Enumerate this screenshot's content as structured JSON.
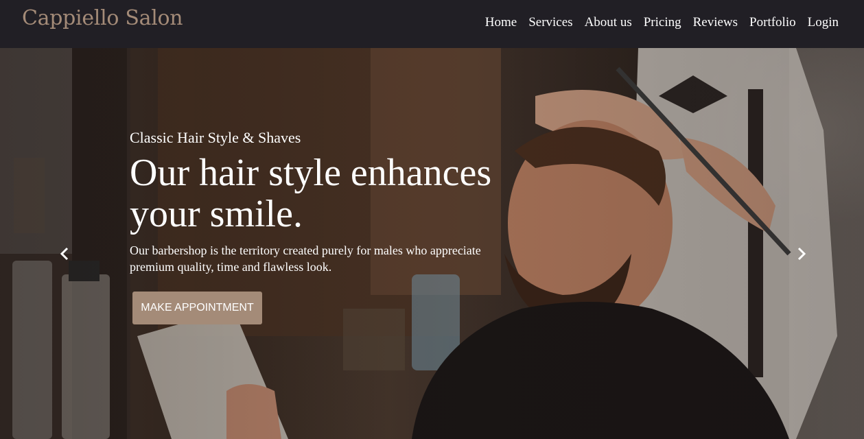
{
  "brand": {
    "name": "Cappiello Salon"
  },
  "nav": {
    "items": [
      {
        "label": "Home"
      },
      {
        "label": "Services"
      },
      {
        "label": "About us"
      },
      {
        "label": "Pricing"
      },
      {
        "label": "Reviews"
      },
      {
        "label": "Portfolio"
      },
      {
        "label": "Login"
      }
    ]
  },
  "hero": {
    "kicker": "Classic Hair Style & Shaves",
    "headline": "Our hair style enhances your smile.",
    "lede": "Our barbershop is the territory created purely for males who appreciate premium quality, time and flawless look.",
    "cta_label": "MAKE APPOINTMENT"
  },
  "carousel": {
    "prev_icon": "chevron-left-icon",
    "next_icon": "chevron-right-icon"
  },
  "colors": {
    "navbar_bg": "#211f25",
    "brand_accent": "#a48b78",
    "nav_text": "#ffffff"
  }
}
